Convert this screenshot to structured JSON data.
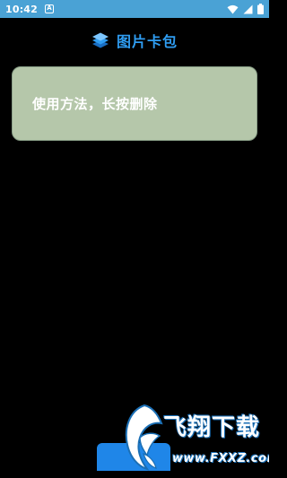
{
  "status_bar": {
    "time": "10:42",
    "notification_badge": "A",
    "icons": [
      "wifi-icon",
      "signal-icon",
      "battery-icon"
    ],
    "background_color": "#4aa2d5"
  },
  "header": {
    "title": "图片卡包",
    "icon": "stack-layers-icon",
    "accent_color": "#2f9df2"
  },
  "tip_card": {
    "text": "使用方法，长按删除",
    "background_color": "#b5c7aa"
  },
  "bottom_button": {
    "color": "#1f86e8"
  },
  "watermark": {
    "text": "飞翔下载",
    "url": "www.FXXZ.com"
  }
}
